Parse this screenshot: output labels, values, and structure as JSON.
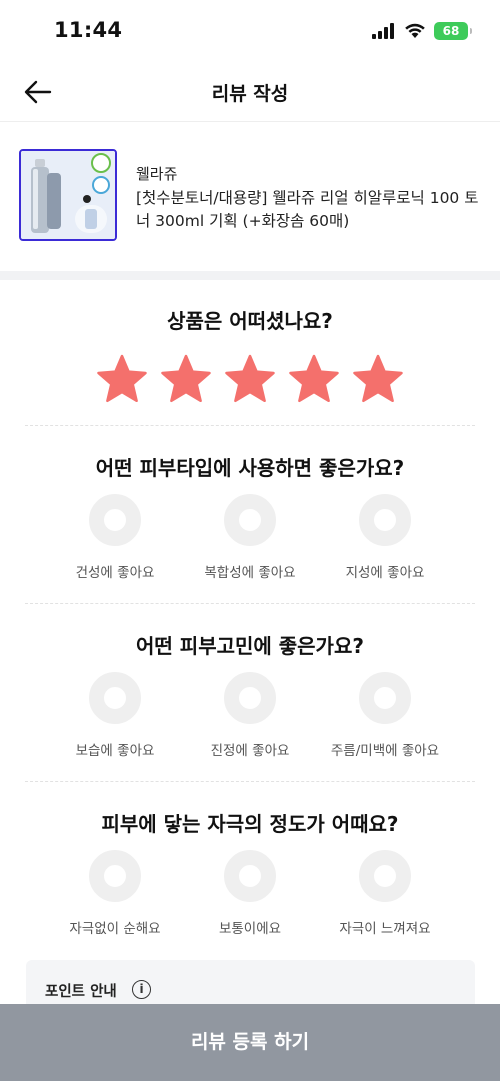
{
  "status_bar": {
    "time": "11:44",
    "battery": "68"
  },
  "header": {
    "title": "리뷰 작성"
  },
  "product": {
    "brand": "웰라쥬",
    "name": "[첫수분토너/대용량] 웰라쥬 리얼 히알루로닉 100 토너 300ml 기획 (+화장솜 60매)"
  },
  "rating": {
    "question": "상품은 어떠셨나요?",
    "stars": 5,
    "max": 5,
    "star_color": "#f4706c"
  },
  "skin_type": {
    "question": "어떤 피부타입에 사용하면 좋은가요?",
    "options": [
      "건성에 좋아요",
      "복합성에 좋아요",
      "지성에 좋아요"
    ]
  },
  "skin_concern": {
    "question": "어떤 피부고민에 좋은가요?",
    "options": [
      "보습에 좋아요",
      "진정에 좋아요",
      "주름/미백에 좋아요"
    ]
  },
  "irritation": {
    "question": "피부에 닿는 자극의 정도가 어때요?",
    "options": [
      "자극없이 순해요",
      "보통이에요",
      "자극이 느껴져요"
    ]
  },
  "point_info": {
    "title": "포인트 안내",
    "icon_glyph": "i"
  },
  "submit": {
    "label": "리뷰 등록 하기",
    "color": "#9197a0"
  }
}
